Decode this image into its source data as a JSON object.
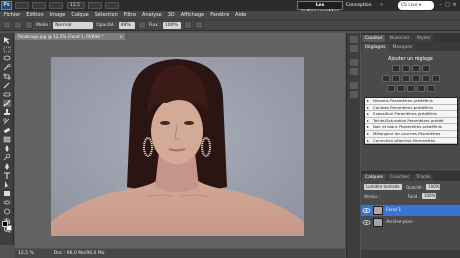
{
  "app": {
    "logo": "Ps",
    "zoom": "12,5",
    "workspace_active": "Les indispensables",
    "workspace_other": "Conception",
    "more": "»",
    "search_placeholder": "CS Live ▾",
    "window_controls": [
      "–",
      "□",
      "×"
    ]
  },
  "menu": [
    "Fichier",
    "Edition",
    "Image",
    "Calque",
    "Sélection",
    "Filtre",
    "Analyse",
    "3D",
    "Affichage",
    "Fenêtre",
    "Aide"
  ],
  "options": {
    "mode_label": "Mode :",
    "mode_value": "Normal",
    "opacity_label": "Opacité :",
    "opacity_value": "49%",
    "flow_label": "Flux :",
    "flow_value": "100%"
  },
  "document": {
    "tab_title": "fenetrage.jpg @ 12,5% (Fond 1, RVB/8) *",
    "close": "×",
    "status_zoom": "12,5 %",
    "status_doc": "Doc : 96,0 Mo/96,0 Mo"
  },
  "panels": {
    "top_tabs": [
      "Couleur",
      "Nuancier",
      "Styles"
    ],
    "adj_tabs": [
      "Réglages",
      "Masques"
    ],
    "adj_title": "Ajouter un réglage",
    "presets": [
      "Niveaux Paramètres prédéfinis",
      "Courbes Paramètres prédéfinis",
      "Exposition Paramètres prédéfinis",
      "Teinte/Saturation Paramètres prédéf.",
      "Noir et blanc Paramètres prédéfinis",
      "Mélangeur de couches Paramètres",
      "Correction sélective Paramètres"
    ]
  },
  "layers": {
    "tabs": [
      "Calques",
      "Couches",
      "Tracés"
    ],
    "blend_mode": "Lumière tamisée",
    "opacity_label": "Opacité :",
    "opacity_value": "100%",
    "lock_label": "Verrou :",
    "fill_label": "Fond :",
    "fill_value": "100%",
    "items": [
      {
        "name": "Fond 1",
        "selected": true
      },
      {
        "name": "Arrière-plan",
        "selected": false
      }
    ]
  },
  "colors": {
    "selection_blue": "#3874d8",
    "panel_bg": "#4a4a4a",
    "app_bg": "#535353"
  }
}
